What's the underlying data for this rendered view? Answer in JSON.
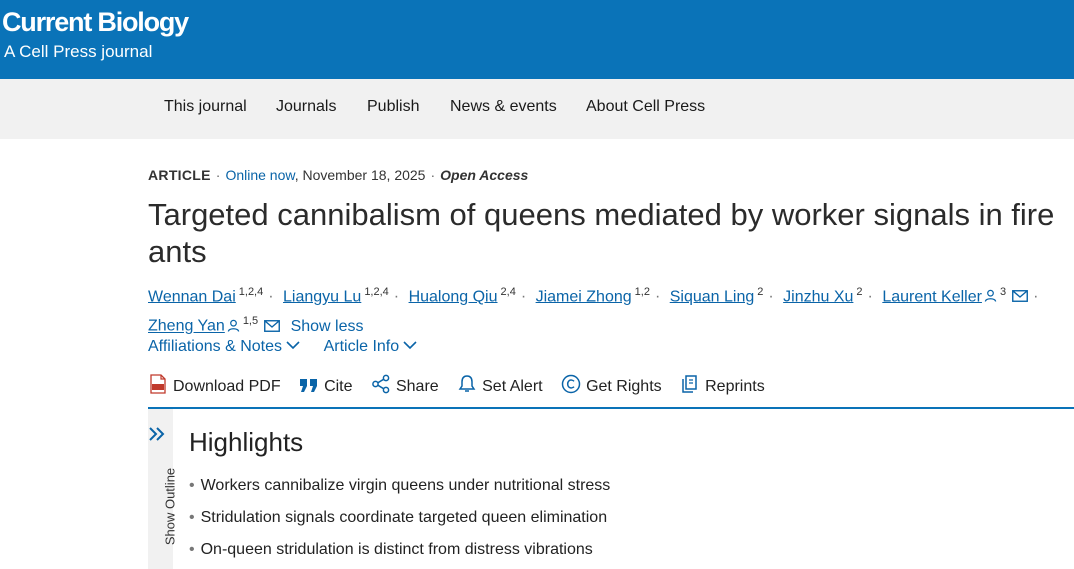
{
  "header": {
    "journal": "Current Biology",
    "subtitle": "A Cell Press journal"
  },
  "nav": {
    "items": [
      "This journal",
      "Journals",
      "Publish",
      "News & events",
      "About Cell Press"
    ]
  },
  "article": {
    "type": "ARTICLE",
    "online": "Online now",
    "date": ", November 18, 2025",
    "access": "Open Access",
    "title": "Targeted cannibalism of queens mediated by worker signals in fire ants"
  },
  "authors": [
    {
      "name": "Wennan Dai",
      "sup": "1,2,4"
    },
    {
      "name": "Liangyu Lu",
      "sup": "1,2,4"
    },
    {
      "name": "Hualong Qiu",
      "sup": "2,4"
    },
    {
      "name": "Jiamei Zhong",
      "sup": "1,2"
    },
    {
      "name": "Siquan Ling",
      "sup": "2"
    },
    {
      "name": "Jinzhu Xu",
      "sup": "2"
    },
    {
      "name": "Laurent Keller",
      "sup": "3"
    },
    {
      "name": "Zheng Yan",
      "sup": "1,5"
    }
  ],
  "show_less": "Show less",
  "accordions": {
    "affiliations": "Affiliations & Notes",
    "article_info": "Article Info"
  },
  "toolbar": {
    "download": "Download PDF",
    "cite": "Cite",
    "share": "Share",
    "alert": "Set Alert",
    "rights": "Get Rights",
    "reprints": "Reprints"
  },
  "outline": {
    "label": "Show Outline"
  },
  "highlights": {
    "title": "Highlights",
    "items": [
      "Workers cannibalize virgin queens under nutritional stress",
      "Stridulation signals coordinate targeted queen elimination",
      "On-queen stridulation is distinct from distress vibrations"
    ]
  },
  "colors": {
    "brand_blue": "#0a73b8",
    "link_blue": "#0a64a8",
    "nav_bg": "#f1f1f1"
  }
}
